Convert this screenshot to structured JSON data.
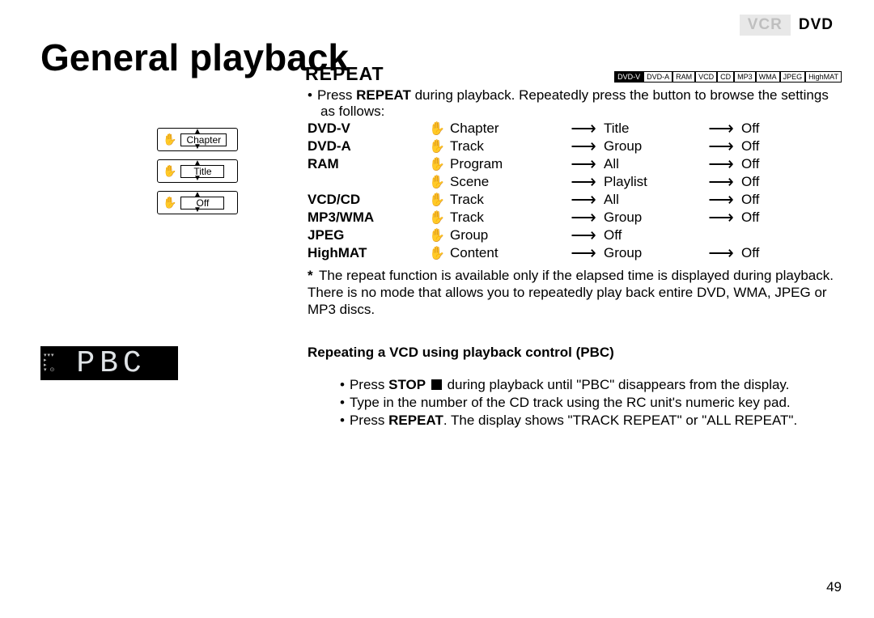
{
  "tabs": {
    "vcr": "VCR",
    "dvd": "DVD"
  },
  "title": "General playback",
  "section": "REPEAT",
  "badges": [
    "DVD-V",
    "DVD-A",
    "RAM",
    "VCD",
    "CD",
    "MP3",
    "WMA",
    "JPEG",
    "HighMAT"
  ],
  "intro_pre": "Press ",
  "intro_bold": "REPEAT",
  "intro_post": " during playback. Repeatedly press the button to browse the settings as follows:",
  "sidebar": {
    "a": "Chapter",
    "b": "Title",
    "c": "Off"
  },
  "arrow": "⟶",
  "ricon": "✋",
  "rows": [
    {
      "fmt": "DVD-V",
      "c1": "Chapter",
      "c2": "Title",
      "c3": "Off"
    },
    {
      "fmt": "DVD-A",
      "c1": "Track",
      "c2": "Group",
      "c3": "Off"
    },
    {
      "fmt": "RAM",
      "c1": "Program",
      "c2": "All",
      "c3": "Off"
    },
    {
      "fmt": "",
      "c1": "Scene",
      "c2": "Playlist",
      "c3": "Off"
    },
    {
      "fmt": "VCD/CD",
      "c1": "Track",
      "c2": "All",
      "c3": "Off"
    },
    {
      "fmt": "MP3/WMA",
      "c1": "Track",
      "c2": "Group",
      "c3": "Off"
    },
    {
      "fmt": "JPEG",
      "c1": "Group",
      "c2": "Off",
      "c3": ""
    },
    {
      "fmt": "HighMAT",
      "c1": "Content",
      "c2": "Group",
      "c3": "Off"
    }
  ],
  "note_star": "*",
  "note": "The repeat function is available only if the elapsed time is displayed during playback. There is no mode that allows you to repeatedly play back entire DVD, WMA, JPEG or MP3 discs.",
  "subhead": "Repeating a VCD using playback control (PBC)",
  "steps": {
    "s1_pre": "Press ",
    "s1_bold": "STOP",
    "s1_post": " during playback until \"PBC\" disappears from the display.",
    "s2": "Type in the number of the CD track using the RC unit's numeric key pad.",
    "s3_pre": "Press ",
    "s3_bold": "REPEAT",
    "s3_post": ". The display shows \"TRACK REPEAT\" or \"ALL REPEAT\"."
  },
  "display": "PBC",
  "page": "49"
}
